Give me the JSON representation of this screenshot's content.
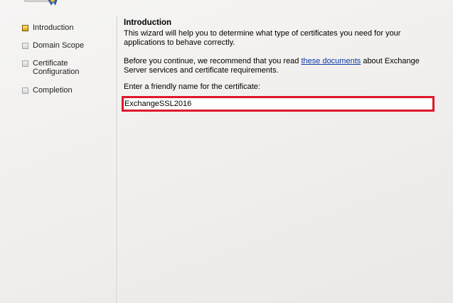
{
  "nav": {
    "steps": [
      {
        "label": "Introduction",
        "active": true
      },
      {
        "label": "Domain Scope",
        "active": false
      },
      {
        "label": "Certificate Configuration",
        "active": false
      },
      {
        "label": "Completion",
        "active": false
      }
    ]
  },
  "main": {
    "title": "Introduction",
    "intro": "This wizard will help you to determine what type of certificates you need for your applications to behave correctly.",
    "before_text": "Before you continue, we recommend that you read ",
    "link_text": "these documents",
    "after_text": " about Exchange Server services and certificate requirements.",
    "field_label": "Enter a friendly name for the certificate:",
    "field_value": "ExchangeSSL2016"
  },
  "colors": {
    "highlight": "#e0162a",
    "link": "#0b3aa0",
    "active_step": "#e4b400"
  },
  "icons": {
    "header": "certificate-wizard-icon",
    "step_active": "current-step-icon",
    "step_inactive": "pending-step-icon"
  }
}
